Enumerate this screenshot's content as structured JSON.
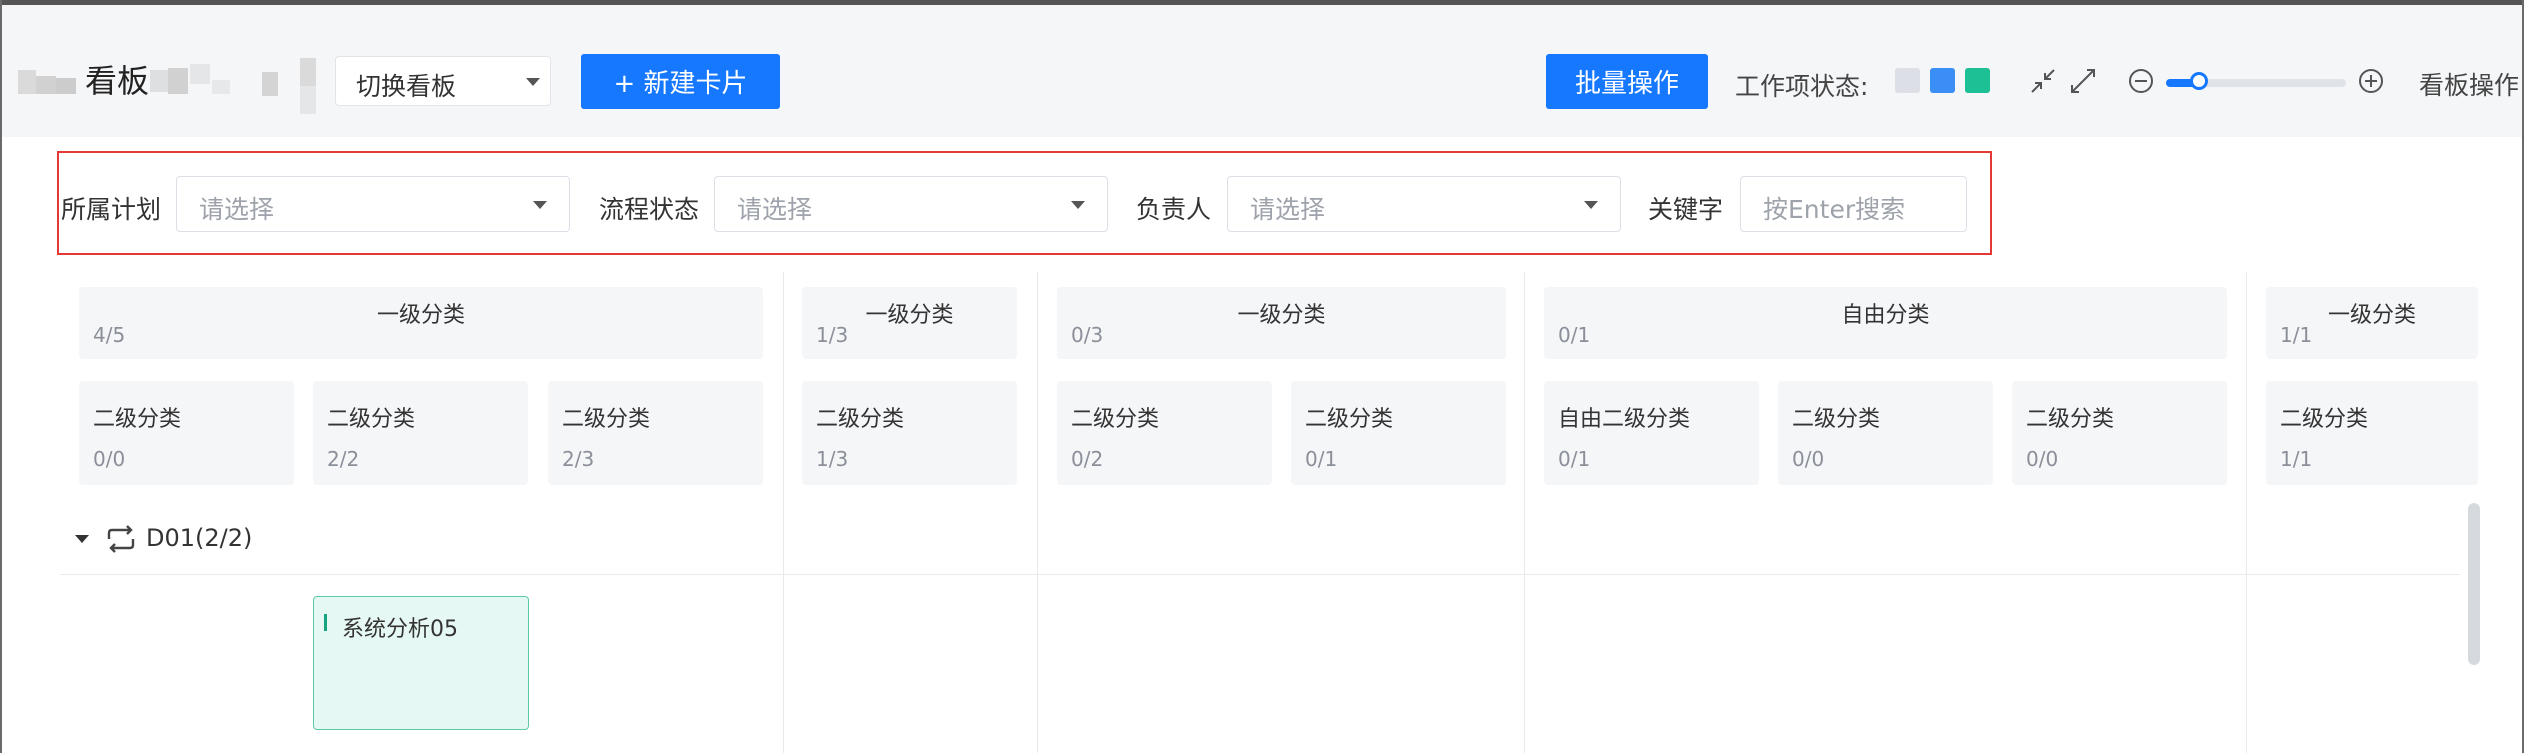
{
  "header": {
    "title": "看板",
    "switch_board": "切换看板",
    "new_card": "+ 新建卡片",
    "batch_ops": "批量操作",
    "work_status_label": "工作项状态:",
    "status_colors": [
      "#dcdfe6",
      "#3a8ef6",
      "#1dbf95"
    ],
    "zoom_level_fraction": 0.12,
    "board_ops": "看板操作"
  },
  "filters": {
    "plan": {
      "label": "所属计划",
      "placeholder": "请选择"
    },
    "flow_status": {
      "label": "流程状态",
      "placeholder": "请选择"
    },
    "owner": {
      "label": "负责人",
      "placeholder": "请选择"
    },
    "keyword": {
      "label": "关键字",
      "placeholder": "按Enter搜索"
    }
  },
  "groups": [
    {
      "title": "一级分类",
      "count": "4/5",
      "subs": [
        {
          "title": "二级分类",
          "count": "0/0"
        },
        {
          "title": "二级分类",
          "count": "2/2"
        },
        {
          "title": "二级分类",
          "count": "2/3"
        }
      ]
    },
    {
      "title": "一级分类",
      "count": "1/3",
      "subs": [
        {
          "title": "二级分类",
          "count": "1/3"
        }
      ]
    },
    {
      "title": "一级分类",
      "count": "0/3",
      "subs": [
        {
          "title": "二级分类",
          "count": "0/2"
        },
        {
          "title": "二级分类",
          "count": "0/1"
        }
      ]
    },
    {
      "title": "自由分类",
      "count": "0/1",
      "subs": [
        {
          "title": "自由二级分类",
          "count": "0/1"
        },
        {
          "title": "二级分类",
          "count": "0/0"
        },
        {
          "title": "二级分类",
          "count": "0/0"
        }
      ]
    },
    {
      "title": "一级分类",
      "count": "1/1",
      "subs": [
        {
          "title": "二级分类",
          "count": "1/1"
        }
      ]
    }
  ],
  "swimlane": {
    "label": "D01(2/2)"
  },
  "cards": [
    {
      "title": "系统分析05"
    }
  ]
}
